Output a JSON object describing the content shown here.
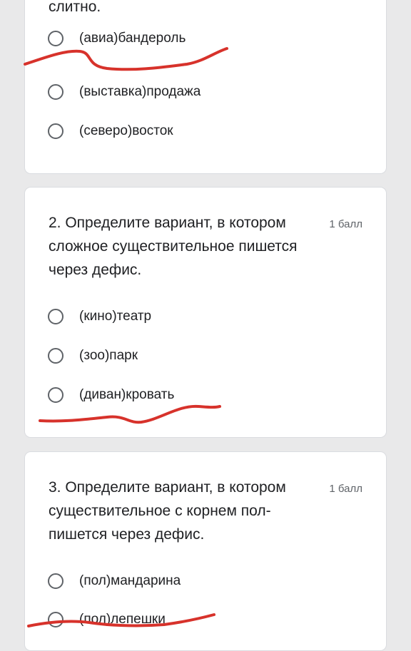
{
  "question1": {
    "text_tail": "слитно.",
    "options": [
      "(авиа)бандероль",
      "(выставка)продажа",
      "(северо)восток"
    ]
  },
  "question2": {
    "text": "2. Определите вариант, в котором сложное существительное пишется через дефис.",
    "points": "1 балл",
    "options": [
      "(кино)театр",
      "(зоо)парк",
      "(диван)кровать"
    ]
  },
  "question3": {
    "text": "3. Определите вариант, в котором существительное с корнем пол- пишется через дефис.",
    "points": "1 балл",
    "options": [
      "(пол)мандарина",
      "(пол)лепешки"
    ]
  },
  "colors": {
    "annotation": "#d7322b",
    "card": "#ffffff",
    "background": "#e9e9ea",
    "radio": "#5f6368"
  }
}
